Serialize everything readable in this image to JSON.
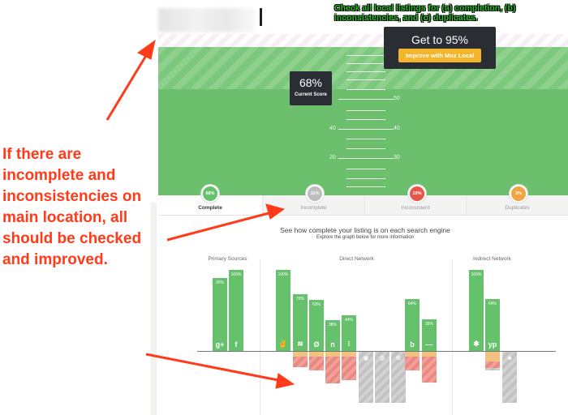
{
  "annotation": {
    "top_text": "Check all local listings for (a) completion, (b) inconsistencies, and (c) duplicates.",
    "side_text": "If there are incomplete and inconsistencies on main location, all should be checked and improved.",
    "color": "#ff3b1a"
  },
  "goal": {
    "title": "Get to 95%",
    "button_label": "Improve with Moz Local"
  },
  "current": {
    "value": "68%",
    "label": "Current Score"
  },
  "scale_ticks": {
    "t60_left": "",
    "t50_right": "50",
    "t40_left": "40",
    "t40_right": "40",
    "t30_left": "20",
    "t30_right": "30"
  },
  "tabs": [
    {
      "label": "Complete",
      "pct": "68%",
      "color": "#65c16b"
    },
    {
      "label": "Incomplete",
      "pct": "11%",
      "color": "#bdbdbd"
    },
    {
      "label": "Inconsistent",
      "pct": "19%",
      "color": "#e8554a"
    },
    {
      "label": "Duplicates",
      "pct": "3%",
      "color": "#f0a541"
    }
  ],
  "section": {
    "subtitle": "See how complete your listing is on each search engine",
    "hint": "Explore the graph below for more information"
  },
  "groups": {
    "primary": "Primary Sources",
    "direct": "Direct Network",
    "indirect": "Indirect Network"
  },
  "chart_data": {
    "type": "bar",
    "note_values": "percent complete per listing source",
    "bars": [
      {
        "icon": "g+",
        "value": 90,
        "label": "90%",
        "neg": 0,
        "negType": "none"
      },
      {
        "icon": "f",
        "value": 100,
        "label": "100%",
        "neg": 0,
        "negType": "none"
      },
      {
        "icon": "✌",
        "value": 100,
        "label": "100%",
        "neg": 0,
        "negType": "none"
      },
      {
        "icon": "≋",
        "value": 70,
        "label": "70%",
        "neg": 30,
        "negType": "red"
      },
      {
        "icon": "Ø",
        "value": 63,
        "label": "63%",
        "neg": 37,
        "negType": "red"
      },
      {
        "icon": "n",
        "value": 38,
        "label": "38%",
        "neg": 62,
        "negType": "red"
      },
      {
        "icon": "⁝",
        "value": 44,
        "label": "44%",
        "neg": 56,
        "negType": "red"
      },
      {
        "icon": "◉",
        "value": 0,
        "label": "",
        "neg": 100,
        "negType": "gray"
      },
      {
        "icon": "◍",
        "value": 0,
        "label": "",
        "neg": 100,
        "negType": "gray"
      },
      {
        "icon": "⊕",
        "value": 0,
        "label": "",
        "neg": 100,
        "negType": "gray"
      },
      {
        "icon": "b",
        "value": 64,
        "label": "64%",
        "neg": 36,
        "negType": "red"
      },
      {
        "icon": "—",
        "value": 39,
        "label": "39%",
        "neg": 61,
        "negType": "red"
      },
      {
        "icon": "✱",
        "value": 100,
        "label": "100%",
        "neg": 0,
        "negType": "none"
      },
      {
        "icon": "yp",
        "value": 64,
        "label": "64%",
        "neg": 36,
        "negType": "mixed"
      },
      {
        "icon": "♣",
        "value": 0,
        "label": "",
        "neg": 100,
        "negType": "gray"
      }
    ]
  }
}
